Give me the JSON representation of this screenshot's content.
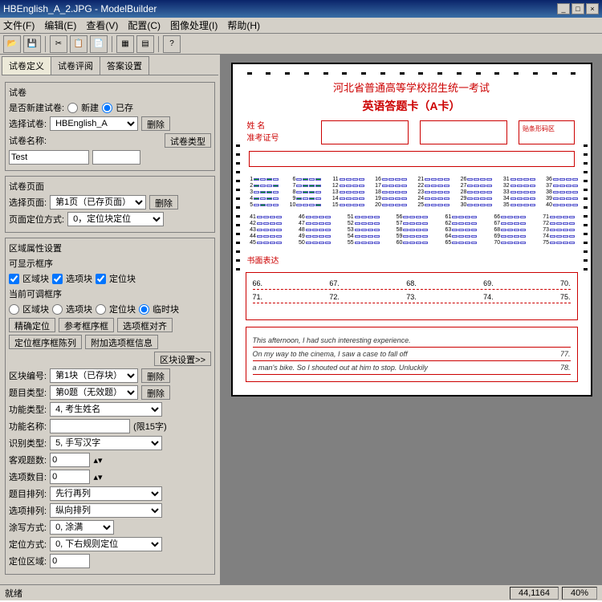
{
  "window": {
    "title": "HBEnglish_A_2.JPG - ModelBuilder"
  },
  "menu": [
    "文件(F)",
    "编辑(E)",
    "查看(V)",
    "配置(C)",
    "图像处理(I)",
    "帮助(H)"
  ],
  "tabs": [
    "试卷定义",
    "试卷评阅",
    "答案设置"
  ],
  "sidebar": {
    "paper_group": "试卷",
    "new_paper_label": "是否新建试卷:",
    "radio_new": "新建",
    "radio_exist": "已存",
    "select_paper_label": "选择试卷:",
    "select_paper_value": "HBEnglish_A",
    "delete_btn": "删除",
    "paper_name_label": "试卷名称:",
    "paper_name_value": "Test",
    "paper_type_btn": "试卷类型",
    "page_group": "试卷页面",
    "select_page_label": "选择页面:",
    "select_page_value": "第1页（已存页面）",
    "page_locate_label": "页面定位方式:",
    "page_locate_value": "0，定位块定位",
    "area_group": "区域属性设置",
    "show_frame_label": "可显示框序",
    "area_block": "区域块",
    "option_block": "选项块",
    "locate_block": "定位块",
    "adjust_frame_label": "当前可调框序",
    "temp_block": "临时块",
    "precise_locate": "精确定位",
    "ref_frame": "参考框序框",
    "align_option": "选项框对齐",
    "locate_frame_seq": "定位框序框陈列",
    "add_option_info": "附加选项框信息",
    "area_setting_btn": "区块设置>>",
    "area_num_label": "区块编号:",
    "area_num_value": "第1块（已存块）",
    "q_type_label": "题目类型:",
    "q_type_value": "第0题（无效题）",
    "func_type_label": "功能类型:",
    "func_type_value": "4, 考生姓名",
    "func_name_label": "功能名称:",
    "func_name_hint": "(限15字)",
    "recog_type_label": "识别类型:",
    "recog_type_value": "5, 手写汉字",
    "obj_q_label": "客观题数:",
    "obj_q_value": "0",
    "option_num_label": "选项数目:",
    "option_num_value": "0",
    "q_arrange_label": "题目排列:",
    "q_arrange_value": "先行再列",
    "opt_arrange_label": "选项排列:",
    "opt_arrange_value": "纵向排列",
    "smear_label": "涂写方式:",
    "smear_value": "0, 涂满",
    "locate_mode_label": "定位方式:",
    "locate_mode_value": "0, 下右规则定位",
    "locate_area_label": "定位区域:",
    "locate_area_value": "0"
  },
  "sheet": {
    "header": "河北省普通高等学校招生统一考试",
    "title": "英语答题卡（A卡）",
    "name_label": "姓    名",
    "exam_id_label": "准考证号",
    "section_title": "书面表达",
    "write_nums": [
      "66.",
      "67.",
      "68.",
      "69.",
      "70."
    ],
    "write_nums2": [
      "71.",
      "72.",
      "73.",
      "74.",
      "75."
    ],
    "essay_lines": [
      "This afternoon, I had such interesting experience.",
      "On my way to the cinema, I saw a case to fall off",
      "a man's bike. So I shouted out at him to stop. Unluckily"
    ],
    "essay_nums": [
      "77.",
      "78."
    ]
  },
  "status": {
    "ready": "就绪",
    "coords": "44,1164",
    "zoom": "40%"
  }
}
